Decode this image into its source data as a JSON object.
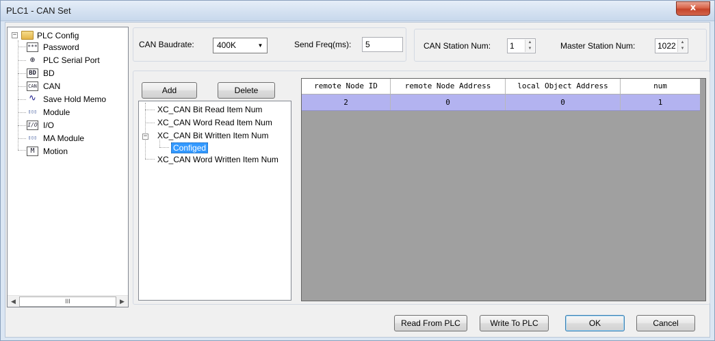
{
  "window": {
    "title": "PLC1 - CAN Set",
    "close_glyph": "x"
  },
  "config_tree": {
    "root_label": "PLC Config",
    "expander_glyph": "−",
    "items": [
      {
        "label": "Password",
        "icon": "password-icon",
        "icon_text": "***"
      },
      {
        "label": "PLC Serial Port",
        "icon": "serial-port-icon",
        "icon_text": "⊕"
      },
      {
        "label": "BD",
        "icon": "bd-icon",
        "icon_text": "BD"
      },
      {
        "label": "CAN",
        "icon": "can-icon",
        "icon_text": "CAN"
      },
      {
        "label": "Save Hold Memo",
        "icon": "waveform-icon",
        "icon_text": "∿"
      },
      {
        "label": "Module",
        "icon": "module-icon",
        "icon_text": "▯▯▯"
      },
      {
        "label": "I/O",
        "icon": "io-icon",
        "icon_text": "I/O"
      },
      {
        "label": "MA Module",
        "icon": "ma-module-icon",
        "icon_text": "▯▯▯"
      },
      {
        "label": "Motion",
        "icon": "motion-icon",
        "icon_text": "M"
      }
    ],
    "scroll_left_glyph": "◀",
    "scroll_right_glyph": "▶",
    "scroll_thumb_glyph": "III"
  },
  "settings": {
    "baudrate_label": "CAN Baudrate:",
    "baudrate_value": "400K",
    "dropdown_glyph": "▼",
    "send_freq_label": "Send Freq(ms):",
    "send_freq_value": "5",
    "station_num_label": "CAN Station Num:",
    "station_num_value": "1",
    "master_station_label": "Master Station Num:",
    "master_station_value": "1022",
    "spin_up_glyph": "▲",
    "spin_down_glyph": "▼"
  },
  "item_buttons": {
    "add_label": "Add",
    "delete_label": "Delete"
  },
  "item_tree": {
    "expander_glyph": "−",
    "items": [
      {
        "label": "XC_CAN Bit Read Item Num"
      },
      {
        "label": "XC_CAN Word Read Item Num"
      },
      {
        "label": "XC_CAN Bit Written Item Num"
      },
      {
        "label": "Configed"
      },
      {
        "label": "XC_CAN Word Written Item Num"
      }
    ]
  },
  "table": {
    "columns": [
      "remote Node ID",
      "remote Node Address",
      "local Object Address",
      "num"
    ],
    "rows": [
      [
        "2",
        "0",
        "0",
        "1"
      ]
    ]
  },
  "footer": {
    "read_label": "Read From PLC",
    "write_label": "Write To PLC",
    "ok_label": "OK",
    "cancel_label": "Cancel"
  }
}
